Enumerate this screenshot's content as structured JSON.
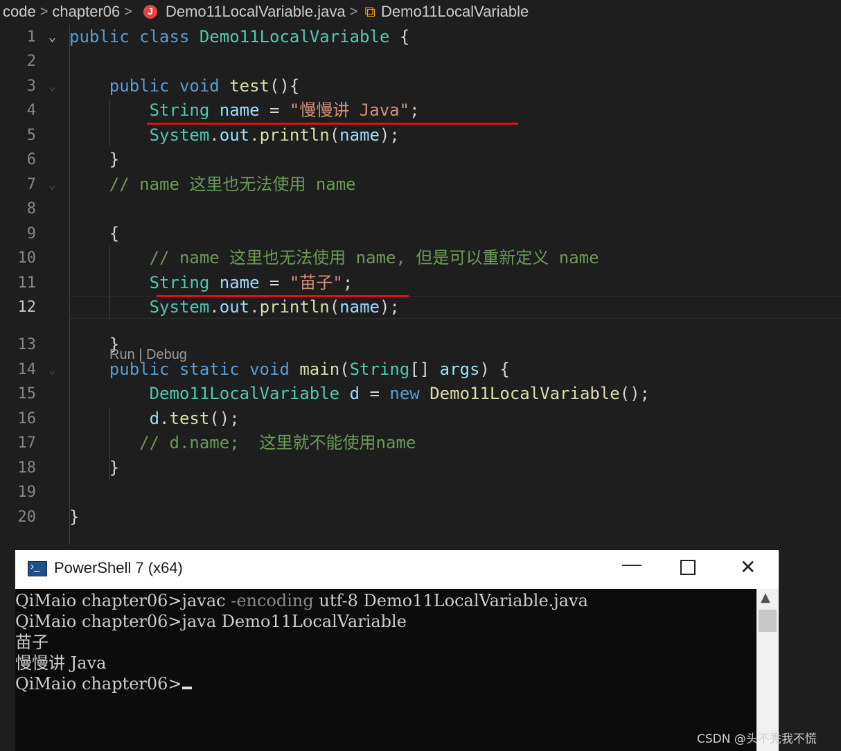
{
  "breadcrumb": {
    "items": [
      "code",
      "chapter06",
      "Demo11LocalVariable.java",
      "Demo11LocalVariable"
    ],
    "separator": ">",
    "file_icon": "java-file-icon",
    "class_icon": "class-symbol-icon"
  },
  "editor": {
    "active_line": 12,
    "codelens": "Run | Debug",
    "lines": [
      {
        "n": "1",
        "tokens": [
          [
            "kw",
            "public"
          ],
          [
            "pl",
            " "
          ],
          [
            "kw",
            "class"
          ],
          [
            "pl",
            " "
          ],
          [
            "ty",
            "Demo11LocalVariable"
          ],
          [
            "pl",
            " {"
          ]
        ]
      },
      {
        "n": "2",
        "tokens": []
      },
      {
        "n": "3",
        "tokens": [
          [
            "pl",
            "    "
          ],
          [
            "kw",
            "public"
          ],
          [
            "pl",
            " "
          ],
          [
            "kw",
            "void"
          ],
          [
            "pl",
            " "
          ],
          [
            "fn",
            "test"
          ],
          [
            "pl",
            "(){"
          ]
        ]
      },
      {
        "n": "4",
        "tokens": [
          [
            "pl",
            "        "
          ],
          [
            "ty",
            "String"
          ],
          [
            "pl",
            " "
          ],
          [
            "va",
            "name"
          ],
          [
            "pl",
            " = "
          ],
          [
            "st",
            "\"慢慢讲 Java\""
          ],
          [
            "pl",
            ";"
          ]
        ]
      },
      {
        "n": "5",
        "tokens": [
          [
            "pl",
            "        "
          ],
          [
            "ty",
            "System"
          ],
          [
            "pl",
            "."
          ],
          [
            "va",
            "out"
          ],
          [
            "pl",
            "."
          ],
          [
            "fn",
            "println"
          ],
          [
            "pl",
            "("
          ],
          [
            "va",
            "name"
          ],
          [
            "pl",
            ");"
          ]
        ]
      },
      {
        "n": "6",
        "tokens": [
          [
            "pl",
            "    }"
          ]
        ]
      },
      {
        "n": "7",
        "tokens": [
          [
            "pl",
            "    "
          ],
          [
            "cm",
            "// name 这里也无法使用 name"
          ]
        ]
      },
      {
        "n": "8",
        "tokens": []
      },
      {
        "n": "9",
        "tokens": [
          [
            "pl",
            "    {"
          ]
        ]
      },
      {
        "n": "10",
        "tokens": [
          [
            "pl",
            "        "
          ],
          [
            "cm",
            "// name 这里也无法使用 name, 但是可以重新定义 name"
          ]
        ]
      },
      {
        "n": "11",
        "tokens": [
          [
            "pl",
            "        "
          ],
          [
            "ty",
            "String"
          ],
          [
            "pl",
            " "
          ],
          [
            "va",
            "name"
          ],
          [
            "pl",
            " = "
          ],
          [
            "st",
            "\"苗子\""
          ],
          [
            "pl",
            ";"
          ]
        ]
      },
      {
        "n": "12",
        "tokens": [
          [
            "pl",
            "        "
          ],
          [
            "ty",
            "System"
          ],
          [
            "pl",
            "."
          ],
          [
            "va",
            "out"
          ],
          [
            "pl",
            "."
          ],
          [
            "fn",
            "println"
          ],
          [
            "pl",
            "("
          ],
          [
            "va",
            "name"
          ],
          [
            "pl",
            ");"
          ]
        ]
      },
      {
        "n": "13",
        "tokens": [
          [
            "pl",
            "    }"
          ]
        ]
      },
      {
        "n": "14",
        "tokens": [
          [
            "pl",
            "    "
          ],
          [
            "kw",
            "public"
          ],
          [
            "pl",
            " "
          ],
          [
            "kw",
            "static"
          ],
          [
            "pl",
            " "
          ],
          [
            "kw",
            "void"
          ],
          [
            "pl",
            " "
          ],
          [
            "fn",
            "main"
          ],
          [
            "pl",
            "("
          ],
          [
            "ty",
            "String"
          ],
          [
            "pl",
            "[] "
          ],
          [
            "va",
            "args"
          ],
          [
            "pl",
            ") {"
          ]
        ]
      },
      {
        "n": "15",
        "tokens": [
          [
            "pl",
            "        "
          ],
          [
            "ty",
            "Demo11LocalVariable"
          ],
          [
            "pl",
            " "
          ],
          [
            "va",
            "d"
          ],
          [
            "pl",
            " = "
          ],
          [
            "kw",
            "new"
          ],
          [
            "pl",
            " "
          ],
          [
            "fn",
            "Demo11LocalVariable"
          ],
          [
            "pl",
            "();"
          ]
        ]
      },
      {
        "n": "16",
        "tokens": [
          [
            "pl",
            "        "
          ],
          [
            "va",
            "d"
          ],
          [
            "pl",
            "."
          ],
          [
            "fn",
            "test"
          ],
          [
            "pl",
            "();"
          ]
        ]
      },
      {
        "n": "17",
        "tokens": [
          [
            "pl",
            "       "
          ],
          [
            "cm",
            "// d.name;  这里就不能使用name"
          ]
        ]
      },
      {
        "n": "18",
        "tokens": [
          [
            "pl",
            "    }"
          ]
        ]
      },
      {
        "n": "19",
        "tokens": []
      },
      {
        "n": "20",
        "tokens": [
          [
            "pl",
            "}"
          ]
        ]
      }
    ]
  },
  "terminal": {
    "title": "PowerShell 7 (x64)",
    "window_icon": "powershell-icon",
    "controls": [
      "minimize-icon",
      "maximize-icon",
      "close-icon"
    ],
    "lines": [
      {
        "prompt": "QiMaio chapter06>",
        "cmd": "javac",
        "light": " -encoding",
        "rest": " utf-8 Demo11LocalVariable.java"
      },
      {
        "prompt": "QiMaio chapter06>",
        "cmd": "java",
        "light": "",
        "rest": " Demo11LocalVariable"
      },
      {
        "prompt": "",
        "cmd": "",
        "light": "",
        "rest": "苗子"
      },
      {
        "prompt": "",
        "cmd": "",
        "light": "",
        "rest": "慢慢讲 Java"
      },
      {
        "prompt": "QiMaio chapter06>",
        "cmd": "",
        "light": "",
        "rest": ""
      }
    ]
  },
  "watermark": "CSDN @头不秃我不慌",
  "colors": {
    "editor_bg": "#1e1e1e",
    "keyword": "#569cd6",
    "type": "#4ec9b0",
    "function": "#dcdcaa",
    "variable": "#9cdcfe",
    "string": "#ce9178",
    "comment": "#6a9955",
    "annotation_underline": "#e01010",
    "terminal_bg": "#0c0c0c"
  }
}
